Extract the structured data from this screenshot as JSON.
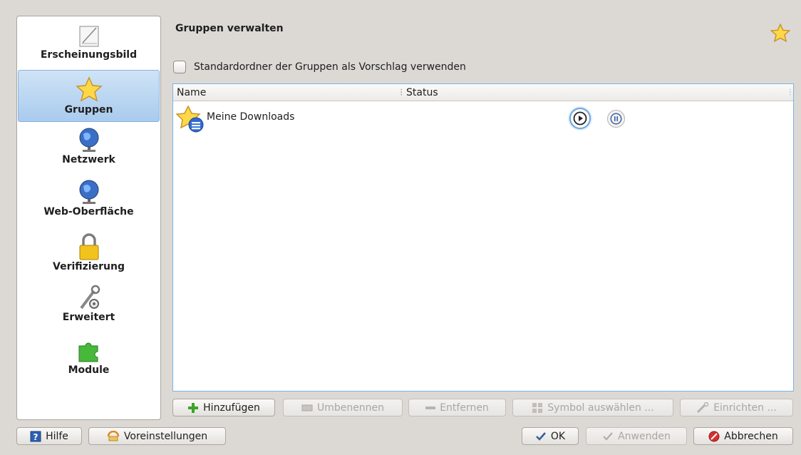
{
  "sidebar": {
    "items": [
      {
        "label": "Erscheinungsbild",
        "icon": "appearance-icon"
      },
      {
        "label": "Gruppen",
        "icon": "star-icon",
        "selected": true
      },
      {
        "label": "Netzwerk",
        "icon": "globe-icon"
      },
      {
        "label": "Web-Oberfläche",
        "icon": "globe-icon"
      },
      {
        "label": "Verifizierung",
        "icon": "lock-icon"
      },
      {
        "label": "Erweitert",
        "icon": "tools-icon"
      },
      {
        "label": "Module",
        "icon": "puzzle-icon"
      }
    ]
  },
  "main": {
    "title": "Gruppen verwalten",
    "checkbox_label": "Standardordner der Gruppen als Vorschlag verwenden",
    "checkbox_checked": false,
    "list": {
      "columns": [
        "Name",
        "Status"
      ],
      "rows": [
        {
          "name": "Meine Downloads",
          "icon": "group-folder-icon",
          "status_buttons": [
            "start-icon",
            "pause-icon"
          ]
        }
      ]
    },
    "actions": {
      "add": "Hinzufügen",
      "rename": "Umbenennen",
      "remove": "Entfernen",
      "symbol": "Symbol auswählen ...",
      "configure": "Einrichten ..."
    }
  },
  "footer": {
    "help": "Hilfe",
    "defaults": "Voreinstellungen",
    "ok": "OK",
    "apply": "Anwenden",
    "cancel": "Abbrechen"
  },
  "colors": {
    "window_bg": "#dcd9d5",
    "selection": "#a9cbee",
    "list_border": "#7cb3e7",
    "add_green": "#3aa42b",
    "cancel_red": "#d62f2f"
  }
}
